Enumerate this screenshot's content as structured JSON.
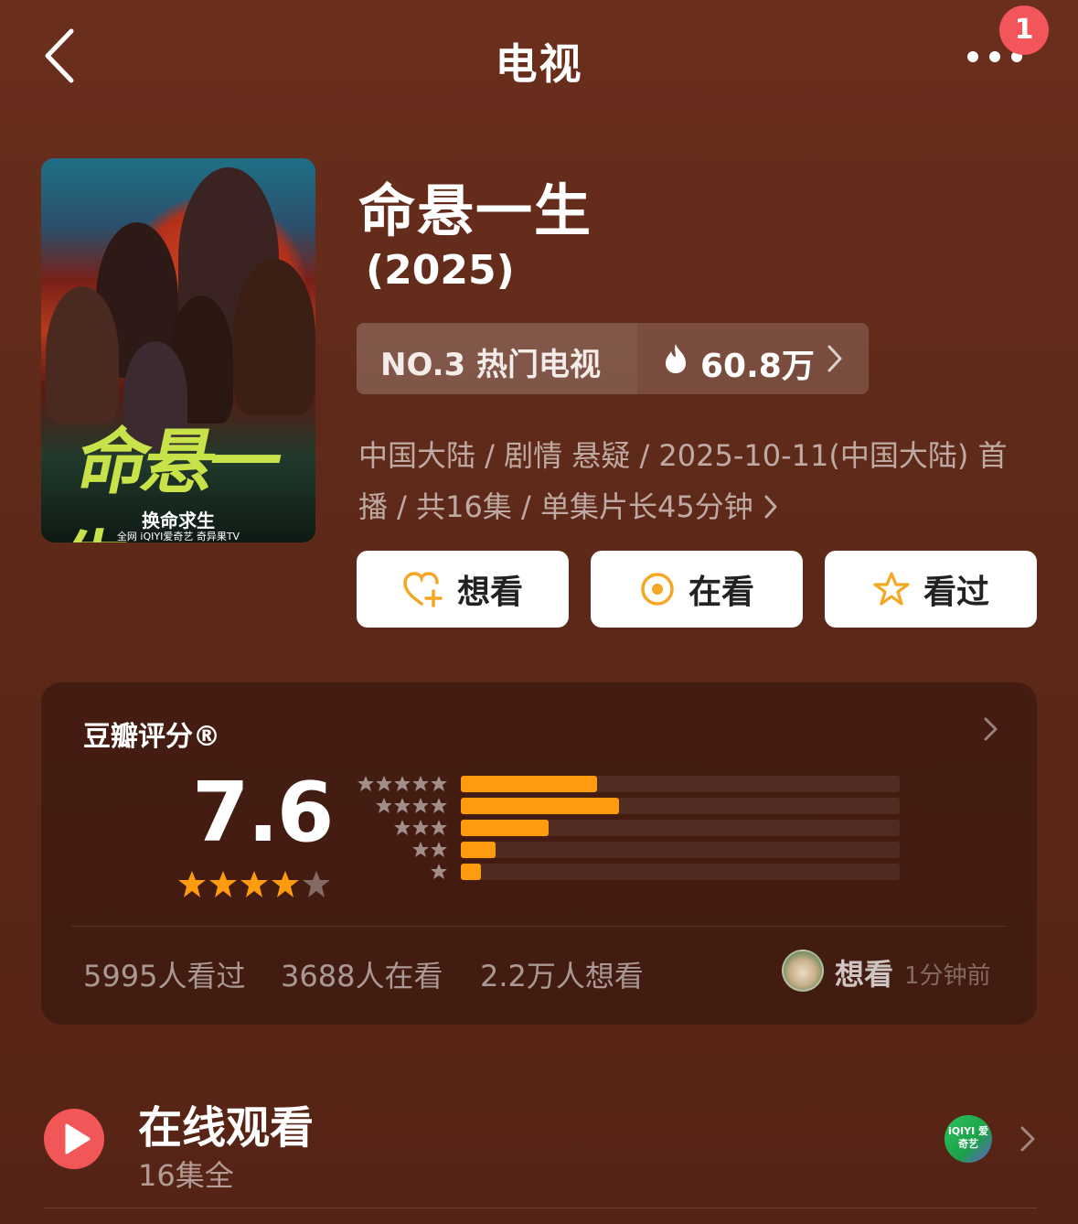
{
  "header": {
    "title": "电视",
    "notification_count": "1"
  },
  "show": {
    "title": "命悬一生",
    "year": "(2025)",
    "poster": {
      "title_art": "命悬一生",
      "tagline": "换命求生",
      "footer": "全网 iQIYI爱奇艺 奇异果TV"
    },
    "rank_label": "NO.3 热门电视",
    "heat_value": "60.8万",
    "meta_line1": "中国大陆 / 剧情 悬疑 / 2025-10-11(中国大陆) 首",
    "meta_line2": "播 / 共16集 / 单集片长45分钟"
  },
  "actions": [
    {
      "label": "想看",
      "icon": "heart-plus-icon"
    },
    {
      "label": "在看",
      "icon": "watching-circle-icon"
    },
    {
      "label": "看过",
      "icon": "star-outline-icon"
    }
  ],
  "rating": {
    "title": "豆瓣评分®",
    "score": "7.6",
    "stars_filled": 4,
    "stars_total": 5,
    "distribution": [
      {
        "stars": 5,
        "fraction": 0.31
      },
      {
        "stars": 4,
        "fraction": 0.36
      },
      {
        "stars": 3,
        "fraction": 0.2
      },
      {
        "stars": 2,
        "fraction": 0.08
      },
      {
        "stars": 1,
        "fraction": 0.045
      }
    ],
    "watched": "5995人看过",
    "watching": "3688人在看",
    "want": "2.2万人想看",
    "friend_action": "想看",
    "friend_time": "1分钟前"
  },
  "online": {
    "title": "在线观看",
    "subtitle": "16集全",
    "provider_logo_text": "iQIYI 爱奇艺"
  },
  "colors": {
    "background": "#5f2a1a",
    "accent_orange": "#ff9b0e",
    "play_red": "#f25757",
    "badge_red": "#f2555a"
  }
}
